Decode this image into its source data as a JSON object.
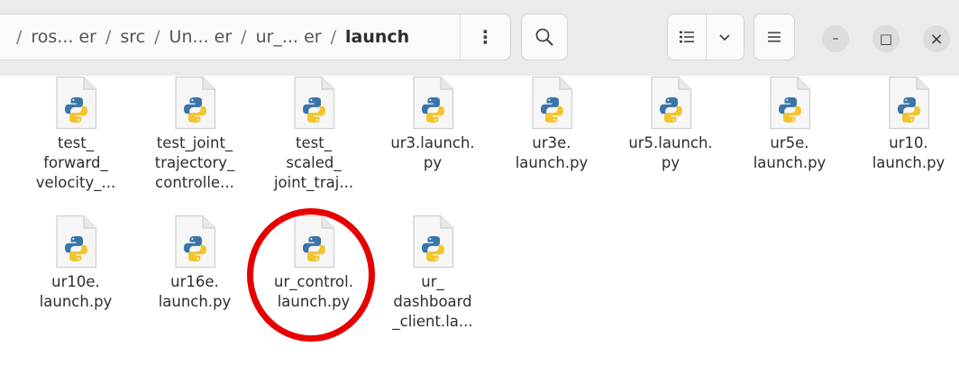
{
  "path": {
    "crumbs": [
      "ros... er",
      "src",
      "Un... er",
      "ur_... er"
    ],
    "separator": "/",
    "current": "launch",
    "menu_glyph": "⋮"
  },
  "toolbar": {
    "search_icon": "search-icon",
    "view_icon": "list-view-icon",
    "view_dropdown_icon": "chevron-down-icon",
    "menu_icon": "hamburger-icon"
  },
  "window_controls": {
    "minimize": "–",
    "maximize": "□",
    "close": "×"
  },
  "colors": {
    "python_blue": "#3a74a9",
    "python_yellow": "#f2c42d",
    "highlight": "#e60000"
  },
  "files": [
    {
      "name": "test_\nforward_\nvelocity_..."
    },
    {
      "name": "test_joint_\ntrajectory_\ncontrolle..."
    },
    {
      "name": "test_\nscaled_\njoint_traj..."
    },
    {
      "name": "ur3.launch.\npy"
    },
    {
      "name": "ur3e.\nlaunch.py"
    },
    {
      "name": "ur5.launch.\npy"
    },
    {
      "name": "ur5e.\nlaunch.py"
    },
    {
      "name": "ur10.\nlaunch.py"
    },
    {
      "name": "ur10e.\nlaunch.py"
    },
    {
      "name": "ur16e.\nlaunch.py"
    },
    {
      "name": "ur_control.\nlaunch.py"
    },
    {
      "name": "ur_\ndashboard\n_client.la..."
    }
  ]
}
